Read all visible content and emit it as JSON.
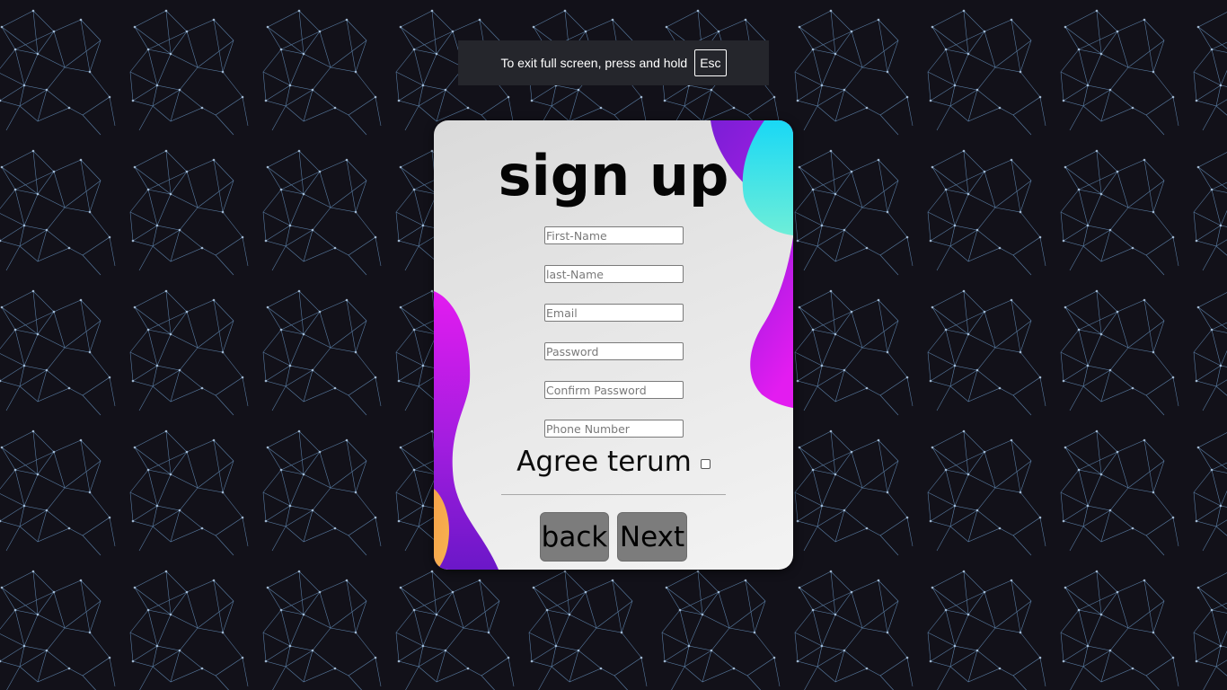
{
  "fullscreen_notice": {
    "message": "To exit full screen, press and hold",
    "key": "Esc"
  },
  "form": {
    "title": "sign up",
    "fields": [
      {
        "name": "first-name",
        "placeholder": "First-Name",
        "value": ""
      },
      {
        "name": "last-name",
        "placeholder": "last-Name",
        "value": ""
      },
      {
        "name": "email",
        "placeholder": "Email",
        "value": ""
      },
      {
        "name": "password",
        "placeholder": "Password",
        "value": ""
      },
      {
        "name": "confirm-password",
        "placeholder": "Confirm Password",
        "value": ""
      },
      {
        "name": "phone-number",
        "placeholder": "Phone Number",
        "value": ""
      }
    ],
    "agree_label": "Agree terum",
    "agree_checked": false,
    "buttons": {
      "back": "back",
      "next": "Next"
    }
  },
  "colors": {
    "page_background": "#121119",
    "pattern_lines": "#6f9fd0",
    "card_background": "#e3e3e3",
    "blob_purple": "#7a1fd6",
    "blob_magenta": "#e31cf0",
    "blob_cyan": "#19d8f5",
    "blob_mint": "#6eeed8",
    "blob_orange": "#f6a24a",
    "button_background": "#7c7c7c"
  }
}
